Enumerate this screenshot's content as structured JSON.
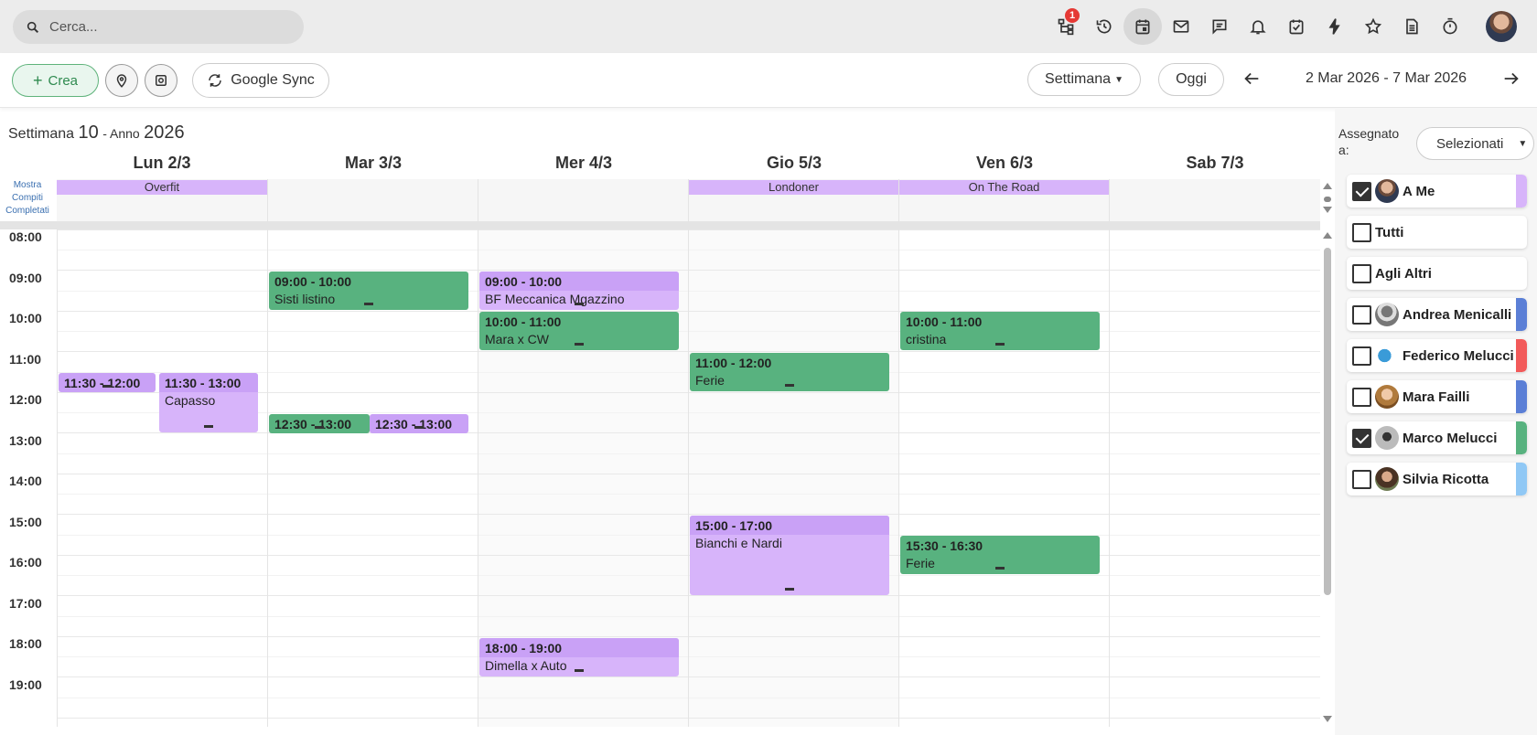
{
  "search": {
    "placeholder": "Cerca..."
  },
  "topbar": {
    "icons": [
      "org-chart-icon",
      "history-icon",
      "calendar-icon",
      "mail-icon",
      "chat-icon",
      "bell-icon",
      "task-check-icon",
      "lightning-icon",
      "star-icon",
      "document-icon",
      "timer-icon"
    ],
    "notification_badge": "1"
  },
  "toolbar": {
    "create_label": "Crea",
    "sync_label": "Google Sync",
    "view_label": "Settimana",
    "today_label": "Oggi",
    "date_range": "2 Mar 2026 - 7 Mar 2026"
  },
  "calendar": {
    "week_prefix": "Settimana",
    "week_number": "10",
    "year_prefix": "- Anno",
    "year": "2026",
    "show_completed": "Mostra Compiti Completati",
    "days": [
      "Lun 2/3",
      "Mar 3/3",
      "Mer 4/3",
      "Gio 5/3",
      "Ven 6/3",
      "Sab 7/3"
    ],
    "hours": [
      "08:00",
      "09:00",
      "10:00",
      "11:00",
      "12:00",
      "13:00",
      "14:00",
      "15:00",
      "16:00",
      "17:00",
      "18:00",
      "19:00"
    ],
    "allday": [
      {
        "day": 0,
        "title": "Overfit"
      },
      {
        "day": 3,
        "title": "Londoner"
      },
      {
        "day": 4,
        "title": "On The Road"
      }
    ],
    "events": [
      {
        "time": "11:30 - 12:00",
        "title": "",
        "color": "purple"
      },
      {
        "time": "11:30 - 13:00",
        "title": "Capasso",
        "color": "purple"
      },
      {
        "time": "09:00 - 10:00",
        "title": "Sisti listino",
        "color": "green"
      },
      {
        "time": "12:30 - 13:00",
        "title": "",
        "color": "green"
      },
      {
        "time": "12:30 - 13:00",
        "title": "",
        "color": "purple"
      },
      {
        "time": "09:00 - 10:00",
        "title": "BF Meccanica Mgazzino",
        "color": "purple"
      },
      {
        "time": "10:00 - 11:00",
        "title": "Mara x CW",
        "color": "green"
      },
      {
        "time": "18:00 - 19:00",
        "title": "Dimella x Auto",
        "color": "purple"
      },
      {
        "time": "11:00 - 12:00",
        "title": "Ferie",
        "color": "green"
      },
      {
        "time": "15:00 - 17:00",
        "title": "Bianchi e Nardi",
        "color": "purple"
      },
      {
        "time": "10:00 - 11:00",
        "title": "cristina",
        "color": "green"
      },
      {
        "time": "15:30 - 16:30",
        "title": "Ferie",
        "color": "green"
      }
    ]
  },
  "assign": {
    "label": "Assegnato a:",
    "select_value": "Selezionati",
    "people": [
      {
        "name": "A Me",
        "checked": true,
        "color": "#d7b4fa"
      },
      {
        "name": "Tutti",
        "checked": false,
        "color": ""
      },
      {
        "name": "Agli Altri",
        "checked": false,
        "color": ""
      },
      {
        "name": "Andrea Menicalli",
        "checked": false,
        "color": "#5b7fd6"
      },
      {
        "name": "Federico Melucci",
        "checked": false,
        "color": "#f25a5a"
      },
      {
        "name": "Mara Failli",
        "checked": false,
        "color": "#5b7fd6"
      },
      {
        "name": "Marco Melucci",
        "checked": true,
        "color": "#58b27f"
      },
      {
        "name": "Silvia Ricotta",
        "checked": false,
        "color": "#90c8f5"
      }
    ]
  },
  "colors": {
    "green_event": "#58b27f",
    "purple_event": "#d7b4fa",
    "accent": "#2e8a4f"
  }
}
